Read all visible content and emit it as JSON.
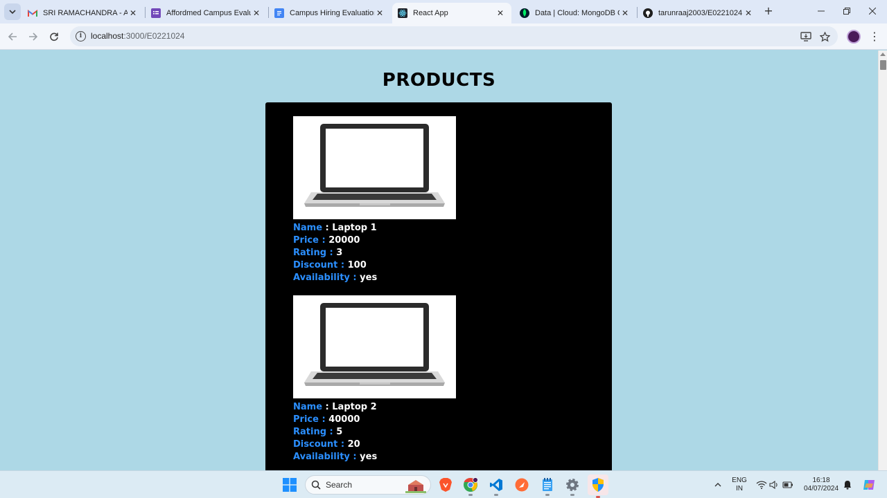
{
  "browser": {
    "tabs": [
      {
        "title": "SRI RAMACHANDRA - Affo",
        "favicon": "gmail-icon",
        "active": false
      },
      {
        "title": "Affordmed Campus Evalua",
        "favicon": "forms-icon",
        "active": false
      },
      {
        "title": "Campus Hiring Evaluation",
        "favicon": "docs-icon",
        "active": false
      },
      {
        "title": "React App",
        "favicon": "react-icon",
        "active": true
      },
      {
        "title": "Data | Cloud: MongoDB Cl",
        "favicon": "mongodb-icon",
        "active": false
      },
      {
        "title": "tarunraaj2003/E0221024",
        "favicon": "github-icon",
        "active": false
      }
    ],
    "url_host": "localhost",
    "url_path": ":3000/E0221024"
  },
  "page": {
    "title": "PRODUCTS",
    "labels": {
      "name": "Name",
      "price": "Price :",
      "rating": "Rating :",
      "discount": "Discount :",
      "availability": "Availability :"
    },
    "products": [
      {
        "name": ": Laptop 1",
        "price": "20000",
        "rating": "3",
        "discount": "100",
        "availability": "yes",
        "image": "laptop-image"
      },
      {
        "name": ": Laptop 2",
        "price": "40000",
        "rating": "5",
        "discount": "20",
        "availability": "yes",
        "image": "laptop-image"
      }
    ],
    "colors": {
      "background": "#add8e6",
      "panel": "#000000",
      "label": "#2b8fff",
      "value": "#ffffff"
    }
  },
  "taskbar": {
    "search_placeholder": "Search",
    "lang_top": "ENG",
    "lang_bottom": "IN",
    "time": "16:18",
    "date": "04/07/2024"
  }
}
